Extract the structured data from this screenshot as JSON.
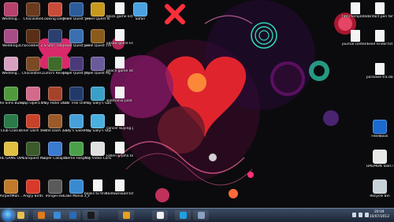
{
  "colors": {
    "wallpaper_base": "#0b0b0e",
    "accent_red": "#e0242e",
    "accent_pink": "#ff2f7a",
    "accent_teal": "#2fd6b0",
    "taskbar": "#1b2536"
  },
  "desktop_icons": [
    {
      "label": "Wedding...",
      "icon": "game-icon",
      "color": "#b5416c"
    },
    {
      "label": "Chocolatier",
      "icon": "game-icon",
      "color": "#6b3a1e"
    },
    {
      "label": "Cooking Dash 3",
      "icon": "game-icon",
      "color": "#c94b3a"
    },
    {
      "label": "Jewel Quest Solitaire",
      "icon": "game-icon",
      "color": "#2c5d9a"
    },
    {
      "label": "Jewel Quest III",
      "icon": "game-icon",
      "color": "#c79a1e"
    },
    {
      "label": "block game list.txt",
      "icon": "text-document-icon",
      "color": "#f4f4f4"
    },
    {
      "label": "Safari",
      "icon": "safari-icon",
      "color": "#4aa3e0"
    },
    {
      "label": "Wedding3",
      "icon": "game-icon",
      "color": "#a84c86"
    },
    {
      "label": "Chocolatier 2 Secret Ing...",
      "icon": "game-icon",
      "color": "#5a2e17"
    },
    {
      "label": "Star Trek",
      "icon": "game-icon",
      "color": "#2d3f6e"
    },
    {
      "label": "Jewel Quest Solitaire II",
      "icon": "game-icon",
      "color": "#3a6fb0"
    },
    {
      "label": "Jewel Quest The Sleepe...",
      "icon": "game-icon",
      "color": "#8a5b1a"
    },
    {
      "label": "jigsaw game list.txt",
      "icon": "text-document-icon",
      "color": "#f4f4f4"
    },
    {
      "label": "Wedding...",
      "icon": "game-icon",
      "color": "#d8a0c0"
    },
    {
      "label": "Chocolatier...",
      "icon": "game-icon",
      "color": "#7a4a24"
    },
    {
      "label": "Zuma's Revenge",
      "icon": "game-icon",
      "color": "#3e6a2a"
    },
    {
      "label": "Jewel Quest Mysteries",
      "icon": "game-icon",
      "color": "#4b3a7a"
    },
    {
      "label": "Jewel Quest Mysteries 2",
      "icon": "game-icon",
      "color": "#6a5a9a"
    },
    {
      "label": "peach game list.txt",
      "icon": "text-document-icon",
      "color": "#f4f4f4"
    },
    {
      "label": "The Sims Bumpin Blast",
      "icon": "game-icon",
      "color": "#4f9a3a"
    },
    {
      "label": "Soap Opera Dash Revi...",
      "icon": "game-icon",
      "color": "#d26a8a"
    },
    {
      "label": "Play Hotel Dash Suite...",
      "icon": "game-icon",
      "color": "#a4432a"
    },
    {
      "label": "Star Trek Online",
      "icon": "game-icon",
      "color": "#223a6a"
    },
    {
      "label": "Play Sally's Salon",
      "icon": "game-icon",
      "color": "#3aa0c8"
    },
    {
      "label": "slotmania pilot pack.rtf",
      "icon": "text-document-icon",
      "color": "#f4f4f4"
    },
    {
      "label": "Club Classic",
      "icon": "game-icon",
      "color": "#2a7a4a"
    },
    {
      "label": "Diner Dash 5 Boom!",
      "icon": "game-icon",
      "color": "#c8422a"
    },
    {
      "label": "Hotel Dash 2 Lost Luxu...",
      "icon": "game-icon",
      "color": "#9a5a2a"
    },
    {
      "label": "Sally's Salon Luxury...",
      "icon": "game-icon",
      "color": "#48a0d8"
    },
    {
      "label": "Play Sally's Studio",
      "icon": "game-icon",
      "color": "#4ab0e0"
    },
    {
      "label": "cancer buying pilot.rtf",
      "icon": "text-document-icon",
      "color": "#f4f4f4"
    },
    {
      "label": "THE GAME OF LIFE",
      "icon": "game-icon",
      "color": "#e0c040"
    },
    {
      "label": "Avanquest Pro",
      "icon": "app-icon",
      "color": "#3a5a2a"
    },
    {
      "label": "Super Collapse 3",
      "icon": "game-icon",
      "color": "#3a7ad0"
    },
    {
      "label": "Theme Hospital",
      "icon": "game-icon",
      "color": "#4aa04a"
    },
    {
      "label": "Any Video Converter",
      "icon": "app-icon",
      "color": "#e0e0e0"
    },
    {
      "label": "Fallen & jahn.txt",
      "icon": "text-document-icon",
      "color": "#f4f4f4"
    },
    {
      "label": "AirportMan...",
      "icon": "game-icon",
      "color": "#c07a2a"
    },
    {
      "label": "Angry Birds",
      "icon": "game-icon",
      "color": "#d83a2a"
    },
    {
      "label": "iRinger.exe",
      "icon": "app-icon",
      "color": "#5a5a5a"
    },
    {
      "label": "Cake Mania 3_Final.exe",
      "icon": "game-icon",
      "color": "#3a8ad0"
    },
    {
      "label": "books to find on kindle.txt",
      "icon": "text-document-icon",
      "color": "#f4f4f4"
    },
    {
      "label": "to download.txt",
      "icon": "text-document-icon",
      "color": "#f4f4f4"
    },
    {
      "label": "html template.txt",
      "icon": "text-document-icon",
      "color": "#f4f4f4"
    },
    {
      "label": "contact peri template.txt",
      "icon": "text-document-icon",
      "color": "#f4f4f4"
    },
    {
      "label": "journal contents.txt",
      "icon": "text-document-icon",
      "color": "#f4f4f4"
    },
    {
      "label": "Feed Finder.txt",
      "icon": "text-document-icon",
      "color": "#f4f4f4"
    },
    {
      "label": "paradise tra.docx",
      "icon": "text-document-icon",
      "color": "#f4f4f4"
    },
    {
      "label": "FeedBack",
      "icon": "app-icon",
      "color": "#1a6ad0"
    },
    {
      "label": "DAEMON Tools Lite",
      "icon": "app-icon",
      "color": "#e8e8e8"
    },
    {
      "label": "Recycle Bin",
      "icon": "recycle-bin-icon",
      "color": "#c8d0d8"
    }
  ],
  "taskbar": {
    "pinned": [
      {
        "name": "folder-icon",
        "color": "#e8c050"
      },
      {
        "name": "media-player-icon",
        "color": "#e07a20"
      },
      {
        "name": "ie-icon",
        "color": "#3a8ad8"
      },
      {
        "name": "photoshop-icon",
        "color": "#2a6ab8"
      },
      {
        "name": "steam-icon",
        "color": "#1a1a1a"
      },
      {
        "name": "winamp-icon",
        "color": "#e8a020"
      },
      {
        "name": "checkmark-icon",
        "color": "#f0f0f0"
      },
      {
        "name": "skype-icon",
        "color": "#20a0e0"
      },
      {
        "name": "window-icon",
        "color": "#8aa0c0"
      }
    ],
    "clock_time": "20:04",
    "clock_date": "10/07/2012"
  }
}
